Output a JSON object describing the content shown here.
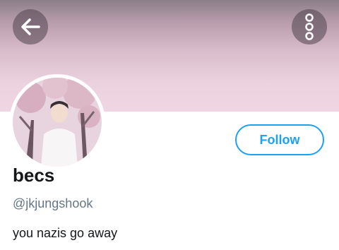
{
  "header": {
    "back_icon": "arrow-left-icon",
    "more_icon": "more-vertical-icon"
  },
  "profile": {
    "display_name": "becs",
    "handle": "@jkjungshook",
    "bio": "you nazis go away",
    "follow_label": "Follow"
  },
  "colors": {
    "accent": "#1da1f2",
    "header_pink": "#efd6e2",
    "handle_gray": "#657786",
    "text_dark": "#14171a"
  }
}
